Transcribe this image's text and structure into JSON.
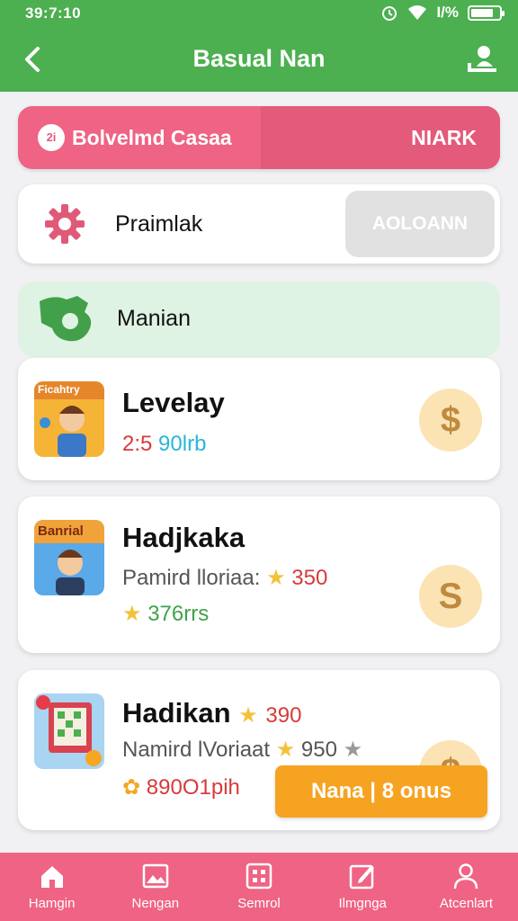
{
  "status": {
    "time": "39:7:10",
    "signal_text": "I/%"
  },
  "app_bar": {
    "title": "Basual Nan"
  },
  "banner": {
    "logo_text": "2i",
    "label": "Bolvelmd Casaa",
    "action": "NIARK"
  },
  "settings_row": {
    "label": "Praimlak",
    "button": "AOLOANN"
  },
  "green_row": {
    "label": "Manian"
  },
  "games": [
    {
      "icon_text": "Ficahtry",
      "title": "Levelay",
      "stat_red": "2:5",
      "stat_cyan": "90lrb",
      "coin": "$"
    },
    {
      "icon_text": "Banrial",
      "title": "Hadjkaka",
      "desc": "Pamird lloriaa:",
      "desc_value": "350",
      "stat_green": "376rrs",
      "coin": "S"
    },
    {
      "title": "Hadikan",
      "title_value": "390",
      "desc": "Namird lVoriaat",
      "desc_value": "950",
      "stat_red": "890O1pih",
      "coin": "$"
    }
  ],
  "bonus_button": "Nana | 8 onus",
  "bottom_nav": [
    {
      "label": "Hamgin",
      "icon": "home-icon"
    },
    {
      "label": "Nengan",
      "icon": "image-icon"
    },
    {
      "label": "Semrol",
      "icon": "grid-icon"
    },
    {
      "label": "Ilmgnga",
      "icon": "edit-icon"
    },
    {
      "label": "Atcenlart",
      "icon": "profile-icon"
    }
  ],
  "colors": {
    "primary_green": "#4caf50",
    "accent_pink": "#ef6384",
    "bonus_orange": "#f7a322",
    "coin_bg": "#fbe3b4"
  }
}
